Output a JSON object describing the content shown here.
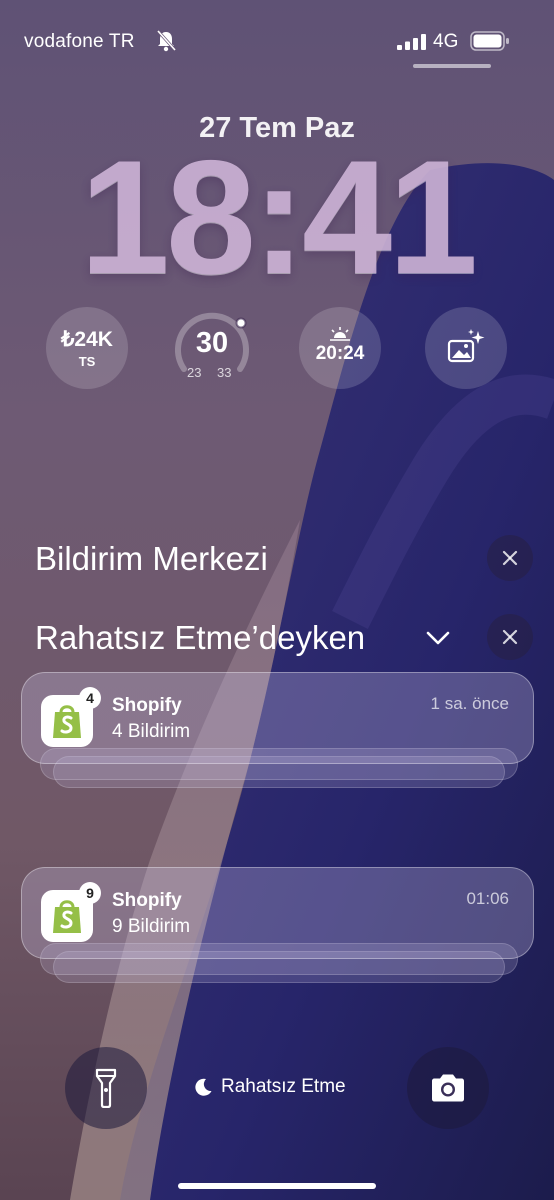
{
  "status_bar": {
    "carrier": "vodafone TR",
    "network": "4G",
    "silent_icon": "bell-slash-icon",
    "signal_icon": "cellular-signal-icon",
    "battery_icon": "battery-full-icon"
  },
  "lock_screen": {
    "date": "27 Tem Paz",
    "time": "18:41"
  },
  "widgets": {
    "price": {
      "value": "₺24K",
      "label": "TS"
    },
    "weather": {
      "current": "30",
      "min": "23",
      "max": "33"
    },
    "sunset": {
      "icon": "sunset-icon",
      "time": "20:24"
    },
    "photos": {
      "icon": "photo-sparkle-icon"
    }
  },
  "notification_center": {
    "title": "Bildirim Merkezi",
    "dnd_section_title": "Rahatsız Etme’deyken"
  },
  "notifications": [
    {
      "app": "Shopify",
      "summary": "4 Bildirim",
      "time": "1 sa. önce",
      "badge": "4"
    },
    {
      "app": "Shopify",
      "summary": "9 Bildirim",
      "time": "01:06",
      "badge": "9"
    }
  ],
  "bottom_bar": {
    "flashlight_icon": "flashlight-icon",
    "focus_label": "Rahatsız Etme",
    "camera_icon": "camera-icon"
  },
  "colors": {
    "wallpaper_top": "#6b5878",
    "wallpaper_dark": "#2c2a68",
    "shopify_green": "#95bf47"
  }
}
